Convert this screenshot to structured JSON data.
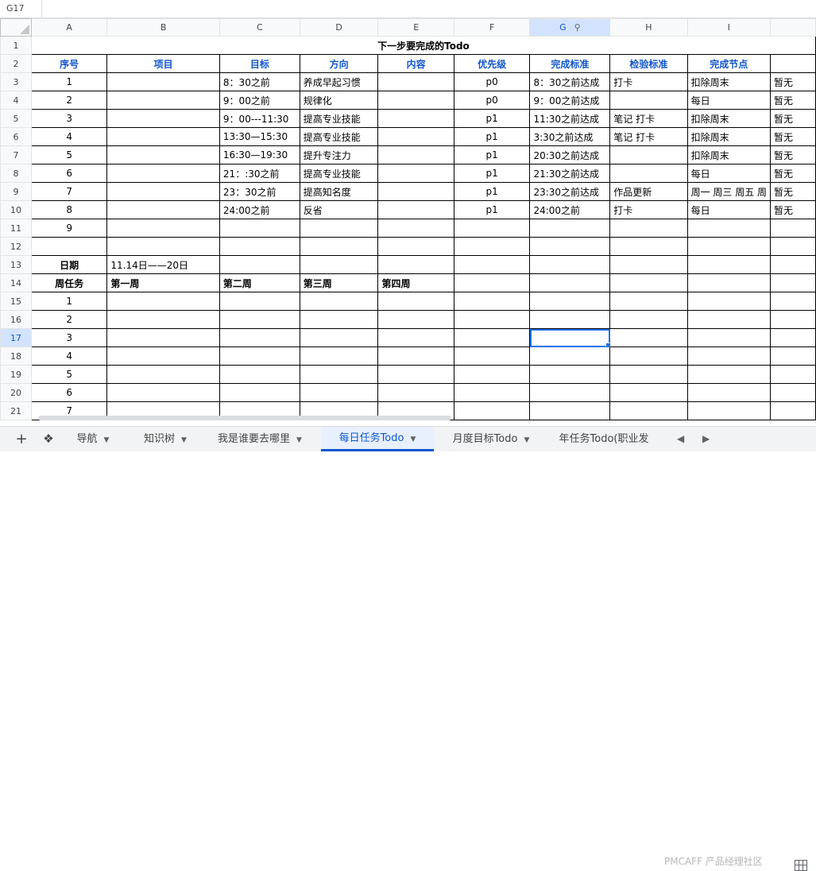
{
  "namebox": "G17",
  "columns": [
    "A",
    "B",
    "C",
    "D",
    "E",
    "F",
    "G",
    "H",
    "I"
  ],
  "row_numbers": [
    "1",
    "2",
    "3",
    "4",
    "5",
    "6",
    "7",
    "8",
    "9",
    "10",
    "11",
    "12",
    "13",
    "14",
    "15",
    "16",
    "17",
    "18",
    "19",
    "20",
    "21"
  ],
  "title": "下一步要完成的Todo",
  "headers": [
    "序号",
    "项目",
    "目标",
    "方向",
    "内容",
    "优先级",
    "完成标准",
    "检验标准",
    "完成节点"
  ],
  "rows": [
    {
      "n": "1",
      "goal": "8：30之前",
      "dir": "养成早起习惯",
      "pri": "p0",
      "std": "8：30之前达成",
      "check": "打卡",
      "node": "扣除周末",
      "extra": "暂无"
    },
    {
      "n": "2",
      "goal": "9：00之前",
      "dir": "规律化",
      "pri": "p0",
      "std": "9：00之前达成",
      "check": "",
      "node": "每日",
      "extra": "暂无"
    },
    {
      "n": "3",
      "goal": "9：00---11:30",
      "dir": "提高专业技能",
      "pri": "p1",
      "std": "11:30之前达成",
      "check": "笔记 打卡",
      "node": "扣除周末",
      "extra": "暂无"
    },
    {
      "n": "4",
      "goal": "13:30—15:30",
      "dir": "提高专业技能",
      "pri": "p1",
      "std": "3:30之前达成",
      "check": "笔记 打卡",
      "node": "扣除周末",
      "extra": "暂无"
    },
    {
      "n": "5",
      "goal": "16:30—19:30",
      "dir": "提升专注力",
      "pri": "p1",
      "std": "20:30之前达成",
      "check": "",
      "node": "扣除周末",
      "extra": "暂无"
    },
    {
      "n": "6",
      "goal": "21：:30之前",
      "dir": "提高专业技能",
      "pri": "p1",
      "std": "21:30之前达成",
      "check": "",
      "node": "每日",
      "extra": "暂无"
    },
    {
      "n": "7",
      "goal": "23：30之前",
      "dir": "提高知名度",
      "pri": "p1",
      "std": "23:30之前达成",
      "check": "作品更新",
      "node": "周一 周三 周五 周",
      "extra": "暂无"
    },
    {
      "n": "8",
      "goal": "24:00之前",
      "dir": "反省",
      "pri": "p1",
      "std": "24:00之前",
      "check": "打卡",
      "node": "每日",
      "extra": "暂无"
    },
    {
      "n": "9",
      "goal": "",
      "dir": "",
      "pri": "",
      "std": "",
      "check": "",
      "node": "",
      "extra": ""
    }
  ],
  "date_label": "日期",
  "date_value": "11.14日——20日",
  "week_label": "周任务",
  "weeks": [
    "第一周",
    "第二周",
    "第三周",
    "第四周"
  ],
  "week_rows": [
    "1",
    "2",
    "3",
    "4",
    "5",
    "6",
    "7"
  ],
  "tabs": [
    {
      "label": "导航",
      "active": false
    },
    {
      "label": "知识树",
      "active": false
    },
    {
      "label": "我是谁要去哪里",
      "active": false
    },
    {
      "label": "每日任务Todo",
      "active": true
    },
    {
      "label": "月度目标Todo",
      "active": false
    },
    {
      "label": "年任务Todo(职业发",
      "active": false
    }
  ],
  "watermark": "PMCAFF 产品经理社区",
  "icons": {
    "add": "plus-icon",
    "sheets": "layers-icon",
    "filter": "filter-icon",
    "grid": "grid-icon"
  },
  "selected_cell": "G17",
  "colors": {
    "header_text": "#1155cc",
    "selection": "#1a73e8",
    "active_tab": "#0b57d0"
  }
}
